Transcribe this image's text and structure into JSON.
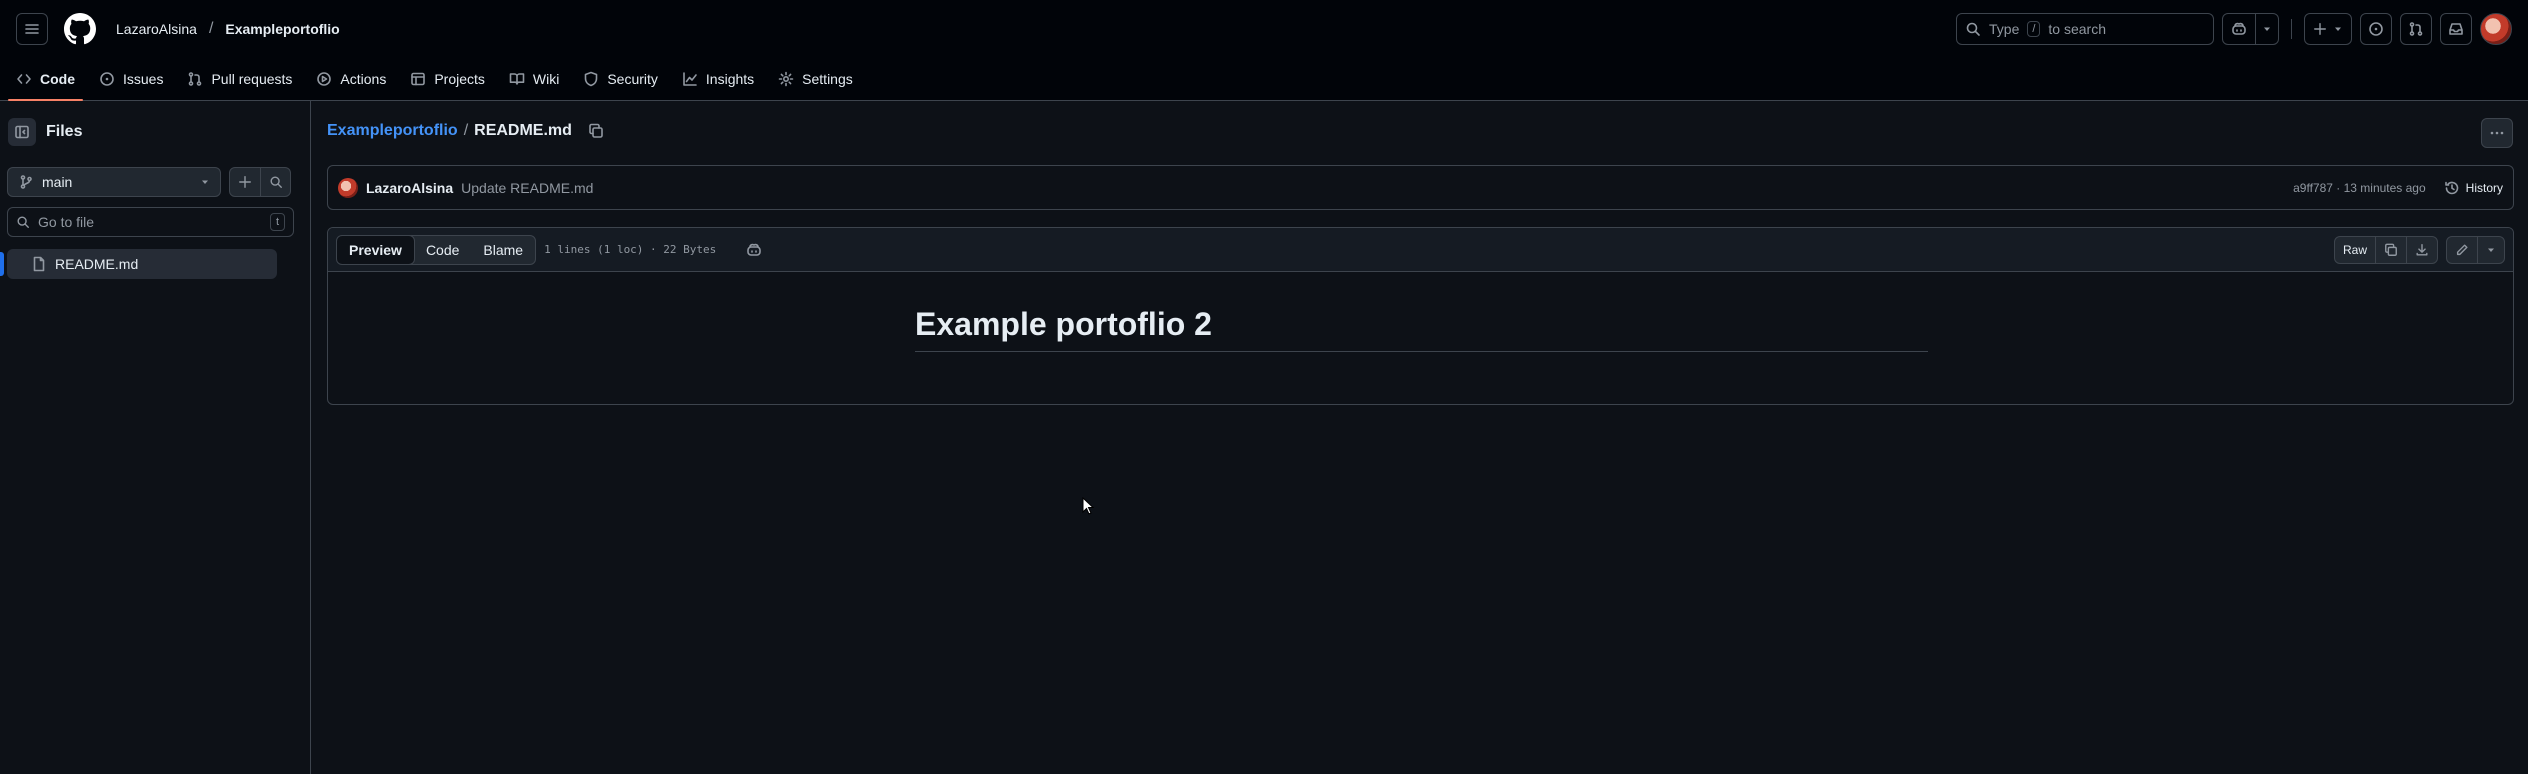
{
  "header": {
    "owner": "LazaroAlsina",
    "separator": "/",
    "repo": "Exampleportoflio",
    "search": {
      "prefix": "Type",
      "key": "/",
      "suffix": "to search"
    }
  },
  "repo_nav": {
    "tabs": [
      {
        "label": "Code",
        "icon": "code-icon",
        "active": true
      },
      {
        "label": "Issues",
        "icon": "issue-opened-icon"
      },
      {
        "label": "Pull requests",
        "icon": "git-pull-request-icon"
      },
      {
        "label": "Actions",
        "icon": "play-icon"
      },
      {
        "label": "Projects",
        "icon": "table-icon"
      },
      {
        "label": "Wiki",
        "icon": "book-icon"
      },
      {
        "label": "Security",
        "icon": "shield-icon"
      },
      {
        "label": "Insights",
        "icon": "graph-icon"
      },
      {
        "label": "Settings",
        "icon": "gear-icon"
      }
    ]
  },
  "sidebar": {
    "title": "Files",
    "branch": "main",
    "go_to_file_placeholder": "Go to file",
    "go_to_file_key": "t",
    "files": [
      {
        "name": "README.md",
        "selected": true
      }
    ]
  },
  "main": {
    "breadcrumb": {
      "repo": "Exampleportoflio",
      "sep": "/",
      "file": "README.md"
    },
    "commit": {
      "author": "LazaroAlsina",
      "message": "Update README.md",
      "meta": "a9ff787 · 13 minutes ago",
      "history_label": "History"
    },
    "file_view": {
      "tabs": [
        "Preview",
        "Code",
        "Blame"
      ],
      "selected_tab": "Preview",
      "info": "1 lines (1 loc) · 22 Bytes",
      "raw_label": "Raw"
    },
    "readme": {
      "heading": "Example portoflio 2"
    }
  },
  "colors": {
    "background": "#0d1117",
    "header_bg": "#010409",
    "border": "#3d444d",
    "link": "#4493f8",
    "active_tab_underline": "#f78166",
    "selected_marker": "#1f6feb"
  }
}
